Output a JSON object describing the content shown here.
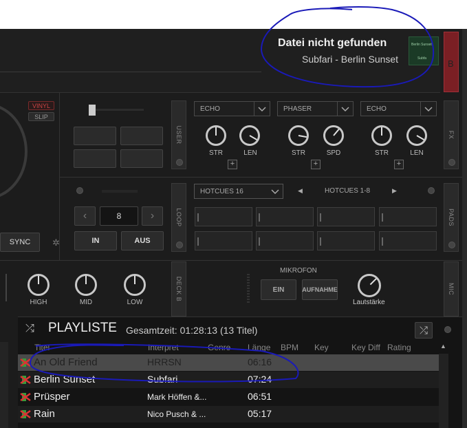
{
  "notification": {
    "title": "Datei nicht gefunden",
    "subtitle": "Subfari - Berlin Sunset",
    "thumb_line1": "Berlin Sunset",
    "thumb_line2": "Subfa"
  },
  "deck": {
    "side_badge": "B"
  },
  "turntable": {
    "vinyl": "VINYL",
    "slip": "SLIP",
    "sync": "SYNC"
  },
  "side_tabs": {
    "user": "USER",
    "loop": "LOOP",
    "deck_b": "DECK B",
    "fx": "FX",
    "pads": "PADS",
    "mic": "MIC"
  },
  "fx": [
    {
      "name": "ECHO",
      "k1": "STR",
      "k2": "LEN"
    },
    {
      "name": "PHASER",
      "k1": "STR",
      "k2": "SPD"
    },
    {
      "name": "ECHO",
      "k1": "STR",
      "k2": "LEN"
    }
  ],
  "loop": {
    "value": "8",
    "in": "IN",
    "out": "AUS",
    "prev": "‹",
    "next": "›"
  },
  "pads": {
    "select": "HOTCUES 16",
    "page": "HOTCUES 1-8"
  },
  "eq": {
    "high": "HIGH",
    "mid": "MID",
    "low": "LOW"
  },
  "mic": {
    "title": "MIKROFON",
    "on": "EIN",
    "rec": "AUFNAHME",
    "volume": "Lautstärke"
  },
  "playlist": {
    "title": "PLAYLISTE",
    "info": "Gesamtzeit: 01:28:13 (13 Titel)",
    "columns": [
      "Titel",
      "Interpret",
      "Genre",
      "Länge",
      "BPM",
      "Key",
      "Key Diff",
      "Rating"
    ],
    "rows": [
      {
        "title": "An Old Friend",
        "artist": "HRRSN",
        "length": "06:16"
      },
      {
        "title": "Berlin Sunset",
        "artist": "Subfari",
        "length": "07:24"
      },
      {
        "title": "Prüsper",
        "artist": "Mark Höffen &...",
        "length": "06:51"
      },
      {
        "title": "Rain",
        "artist": "Nico Pusch & ...",
        "length": "05:17"
      }
    ]
  },
  "colors": {
    "accent_red": "#7a1f24",
    "annotation": "#1a1ab8",
    "thumb_green": "#1b3a26"
  }
}
